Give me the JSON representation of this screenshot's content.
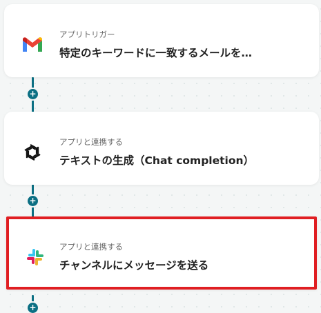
{
  "steps": [
    {
      "type_label": "アプリトリガー",
      "title": "特定のキーワードに一致するメールを…",
      "icon": "gmail-icon"
    },
    {
      "type_label": "アプリと連携する",
      "title": "テキストの生成（Chat completion）",
      "icon": "openai-icon"
    },
    {
      "type_label": "アプリと連携する",
      "title": "チャンネルにメッセージを送る",
      "icon": "slack-icon",
      "highlighted": true
    }
  ],
  "add_node_symbol": "+",
  "colors": {
    "connector": "#0b6f83",
    "highlight_border": "#e01e22",
    "gmail_red": "#ea4335",
    "gmail_blue": "#4285f4",
    "gmail_green": "#34a853",
    "gmail_yellow": "#fbbc04",
    "slack_red": "#e01e5a",
    "slack_green": "#2eb67d",
    "slack_blue": "#36c5f0",
    "slack_yellow": "#ecb22e"
  }
}
